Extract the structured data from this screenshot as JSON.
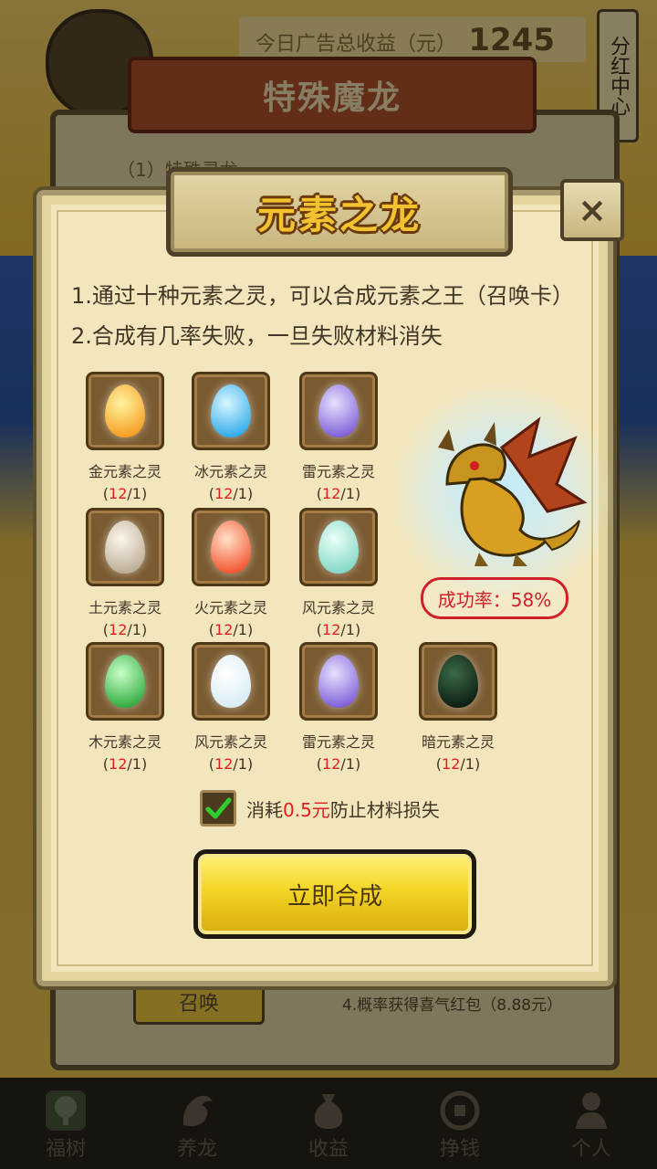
{
  "background": {
    "ad_revenue_label": "今日广告总收益（元）",
    "ad_revenue_value": "1245",
    "dividend_center": "分红中心",
    "back_panel_title": "特殊魔龙",
    "back_panel_text": "（1）特殊灵龙…",
    "summon_button": "召唤",
    "back_note": "4.概率获得喜气红包（8.88元）"
  },
  "nav": [
    {
      "label": "福树",
      "icon": "tree-icon"
    },
    {
      "label": "养龙",
      "icon": "dragon-icon"
    },
    {
      "label": "收益",
      "icon": "money-bag-icon"
    },
    {
      "label": "挣钱",
      "icon": "coin-icon"
    },
    {
      "label": "个人",
      "icon": "person-icon"
    }
  ],
  "dialog": {
    "title": "元素之龙",
    "close_label": "×",
    "rules": [
      "1.通过十种元素之灵，可以合成元素之王（召唤卡）",
      "2.合成有几率失败，一旦失败材料消失"
    ],
    "eggs": [
      {
        "name": "金元素之灵",
        "have": "12",
        "need": "1",
        "color_a": "#fff3a0",
        "color_b": "#f59a1c"
      },
      {
        "name": "冰元素之灵",
        "have": "12",
        "need": "1",
        "color_a": "#d8f6ff",
        "color_b": "#2aa8e8"
      },
      {
        "name": "雷元素之灵",
        "have": "12",
        "need": "1",
        "color_a": "#e8e0ff",
        "color_b": "#7a5cd6"
      },
      {
        "name": "土元素之灵",
        "have": "12",
        "need": "1",
        "color_a": "#fbf6ec",
        "color_b": "#b9aa92"
      },
      {
        "name": "火元素之灵",
        "have": "12",
        "need": "1",
        "color_a": "#ffe0c8",
        "color_b": "#f2502a"
      },
      {
        "name": "风元素之灵",
        "have": "12",
        "need": "1",
        "color_a": "#eafff8",
        "color_b": "#7fd6c4"
      },
      {
        "name": "木元素之灵",
        "have": "12",
        "need": "1",
        "color_a": "#c8ffc8",
        "color_b": "#2ca83a"
      },
      {
        "name": "风元素之灵",
        "have": "12",
        "need": "1",
        "color_a": "#ffffff",
        "color_b": "#d6ecf4"
      },
      {
        "name": "雷元素之灵",
        "have": "12",
        "need": "1",
        "color_a": "#e8e0ff",
        "color_b": "#7a5cd6"
      },
      {
        "name": "暗元素之灵",
        "have": "12",
        "need": "1",
        "color_a": "#3a6a46",
        "color_b": "#0c1a10"
      }
    ],
    "success_rate": "成功率：58%",
    "consume_prefix": "消耗",
    "consume_price": "0.5元",
    "consume_suffix": "防止材料损失",
    "synthesize_button": "立即合成"
  }
}
